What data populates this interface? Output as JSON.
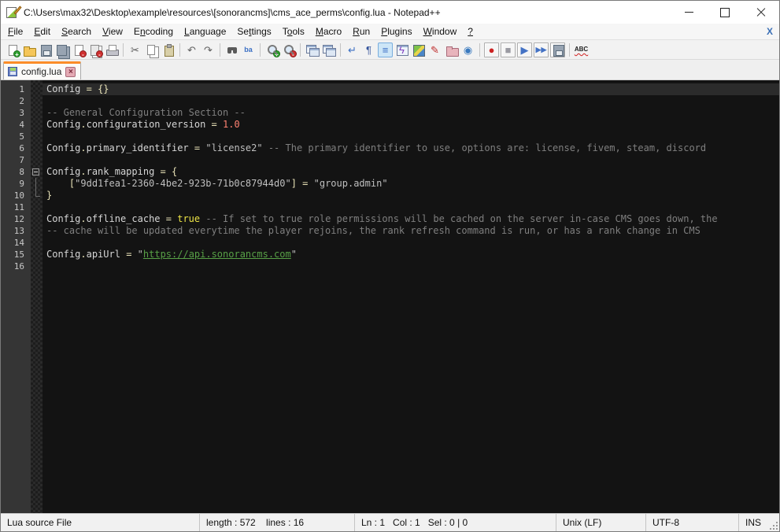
{
  "window": {
    "title": "C:\\Users\\max32\\Desktop\\example\\resources\\[sonorancms]\\cms_ace_perms\\config.lua - Notepad++"
  },
  "menu": {
    "items": [
      {
        "id": "file",
        "pre": "",
        "mn": "F",
        "post": "ile"
      },
      {
        "id": "edit",
        "pre": "",
        "mn": "E",
        "post": "dit"
      },
      {
        "id": "search",
        "pre": "",
        "mn": "S",
        "post": "earch"
      },
      {
        "id": "view",
        "pre": "",
        "mn": "V",
        "post": "iew"
      },
      {
        "id": "encoding",
        "pre": "E",
        "mn": "n",
        "post": "coding"
      },
      {
        "id": "language",
        "pre": "",
        "mn": "L",
        "post": "anguage"
      },
      {
        "id": "settings",
        "pre": "Se",
        "mn": "t",
        "post": "tings"
      },
      {
        "id": "tools",
        "pre": "T",
        "mn": "o",
        "post": "ols"
      },
      {
        "id": "macro",
        "pre": "",
        "mn": "M",
        "post": "acro"
      },
      {
        "id": "run",
        "pre": "",
        "mn": "R",
        "post": "un"
      },
      {
        "id": "plugins",
        "pre": "",
        "mn": "P",
        "post": "lugins"
      },
      {
        "id": "window",
        "pre": "",
        "mn": "W",
        "post": "indow"
      },
      {
        "id": "help",
        "pre": "",
        "mn": "?",
        "post": ""
      }
    ],
    "close_label": "X"
  },
  "toolbar": {
    "items": [
      {
        "name": "new-file-icon",
        "shape": "page",
        "badge": "+",
        "badgeStyle": "plus"
      },
      {
        "name": "open-file-icon",
        "shape": "folder"
      },
      {
        "name": "save-icon",
        "shape": "floppy"
      },
      {
        "name": "save-all-icon",
        "shape": "floppy2"
      },
      {
        "name": "close-icon",
        "shape": "page",
        "badge": "-",
        "badgeStyle": "minus"
      },
      {
        "name": "close-all-icon",
        "shape": "pages",
        "badge": "-",
        "badgeStyle": "minus"
      },
      {
        "name": "print-icon",
        "shape": "printer"
      },
      {
        "sep": true
      },
      {
        "name": "cut-icon",
        "glyph": "✂",
        "color": "#5a5a5a"
      },
      {
        "name": "copy-icon",
        "shape": "copy"
      },
      {
        "name": "paste-icon",
        "shape": "clipboard"
      },
      {
        "sep": true
      },
      {
        "name": "undo-icon",
        "glyph": "↶",
        "color": "#606060"
      },
      {
        "name": "redo-icon",
        "glyph": "↷",
        "color": "#606060"
      },
      {
        "sep": true
      },
      {
        "name": "find-icon",
        "shape": "binoculars"
      },
      {
        "name": "replace-icon",
        "glyph": "ba",
        "color": "#3a6fc4",
        "small": true
      },
      {
        "sep": true
      },
      {
        "name": "zoom-in-icon",
        "shape": "magnifier",
        "badge": "+",
        "badgeStyle": "plus"
      },
      {
        "name": "zoom-out-icon",
        "shape": "magnifier",
        "badge": "-",
        "badgeStyle": "minus"
      },
      {
        "sep": true
      },
      {
        "name": "sync-vertical-scroll-icon",
        "shape": "windows",
        "badge": "",
        "badgeStyle": "lock"
      },
      {
        "name": "sync-horizontal-scroll-icon",
        "shape": "windows",
        "badge": "",
        "badgeStyle": "lock"
      },
      {
        "sep": true
      },
      {
        "name": "word-wrap-icon",
        "glyph": "↵",
        "color": "#3a6fc4"
      },
      {
        "name": "show-all-characters-icon",
        "glyph": "¶",
        "color": "#34549c"
      },
      {
        "name": "indent-guide-icon",
        "glyph": "≡",
        "color": "#3a6fc4",
        "active": true
      },
      {
        "name": "doc-switcher-icon",
        "glyph": "ϟ",
        "color": "#8040c0",
        "shape": "window"
      },
      {
        "name": "document-map-icon",
        "shape": "map"
      },
      {
        "name": "function-list-icon",
        "glyph": "✎",
        "color": "#c03030"
      },
      {
        "name": "folder-as-workspace-icon",
        "shape": "folderpink"
      },
      {
        "name": "monitoring-icon",
        "glyph": "◉",
        "color": "#3a7abf"
      },
      {
        "sep": true
      },
      {
        "name": "macro-record-icon",
        "glyph": "●",
        "color": "#cc2222",
        "shape": "box"
      },
      {
        "name": "macro-stop-icon",
        "glyph": "■",
        "color": "#9a9aa2",
        "shape": "box"
      },
      {
        "name": "macro-play-icon",
        "glyph": "▶",
        "color": "#4472c4",
        "shape": "box"
      },
      {
        "name": "macro-run-multiple-icon",
        "glyph": "▶▶",
        "color": "#4472c4",
        "shape": "box",
        "small": true
      },
      {
        "name": "macro-save-icon",
        "shape": "floppy box"
      },
      {
        "sep": true
      },
      {
        "name": "spell-check-icon",
        "glyph": "ABC",
        "color": "#222222",
        "abc": true
      }
    ]
  },
  "tab": {
    "label": "config.lua",
    "close_label": "×",
    "accent_color": "#fb8c28"
  },
  "editor": {
    "colors": {
      "background": "#131313",
      "current_line": "#2b2b2b",
      "default_text": "#d6d6d6",
      "operator": "#e8e2b7",
      "comment": "#7f7f7f",
      "string": "#bfbfbf",
      "number": "#ff8272",
      "keyword": "#ece345",
      "url": "#57a046"
    },
    "lines": [
      {
        "n": 1,
        "current": true,
        "tokens": [
          [
            "Config",
            "d"
          ],
          [
            " ",
            "d"
          ],
          [
            "=",
            "o"
          ],
          [
            " ",
            "d"
          ],
          [
            "{}",
            "o"
          ]
        ]
      },
      {
        "n": 2,
        "tokens": []
      },
      {
        "n": 3,
        "tokens": [
          [
            "-- General Configuration Section --",
            "c"
          ]
        ]
      },
      {
        "n": 4,
        "tokens": [
          [
            "Config",
            "d"
          ],
          [
            ".",
            "o"
          ],
          [
            "configuration_version",
            "d"
          ],
          [
            " ",
            "d"
          ],
          [
            "=",
            "o"
          ],
          [
            " ",
            "d"
          ],
          [
            "1.0",
            "n"
          ]
        ]
      },
      {
        "n": 5,
        "tokens": []
      },
      {
        "n": 6,
        "tokens": [
          [
            "Config",
            "d"
          ],
          [
            ".",
            "o"
          ],
          [
            "primary_identifier",
            "d"
          ],
          [
            " ",
            "d"
          ],
          [
            "=",
            "o"
          ],
          [
            " ",
            "d"
          ],
          [
            "\"license2\"",
            "s"
          ],
          [
            " ",
            "d"
          ],
          [
            "-- The primary identifier to use, options are: license, fivem, steam, discord",
            "c"
          ]
        ]
      },
      {
        "n": 7,
        "tokens": []
      },
      {
        "n": 8,
        "fold": "open",
        "tokens": [
          [
            "Config",
            "d"
          ],
          [
            ".",
            "o"
          ],
          [
            "rank_mapping",
            "d"
          ],
          [
            " ",
            "d"
          ],
          [
            "=",
            "o"
          ],
          [
            " ",
            "d"
          ],
          [
            "{",
            "o"
          ]
        ]
      },
      {
        "n": 9,
        "fold": "guide",
        "tokens": [
          [
            "    ",
            "d"
          ],
          [
            "[",
            "o"
          ],
          [
            "\"9dd1fea1-2360-4be2-923b-71b0c87944d0\"",
            "s"
          ],
          [
            "]",
            "o"
          ],
          [
            " ",
            "d"
          ],
          [
            "=",
            "o"
          ],
          [
            " ",
            "d"
          ],
          [
            "\"group.admin\"",
            "s"
          ]
        ]
      },
      {
        "n": 10,
        "fold": "end",
        "tokens": [
          [
            "}",
            "o"
          ]
        ]
      },
      {
        "n": 11,
        "tokens": []
      },
      {
        "n": 12,
        "tokens": [
          [
            "Config",
            "d"
          ],
          [
            ".",
            "o"
          ],
          [
            "offline_cache",
            "d"
          ],
          [
            " ",
            "d"
          ],
          [
            "=",
            "o"
          ],
          [
            " ",
            "d"
          ],
          [
            "true",
            "k"
          ],
          [
            " ",
            "d"
          ],
          [
            "-- If set to true role permissions will be cached on the server in-case CMS goes down, the",
            "c"
          ]
        ]
      },
      {
        "n": 13,
        "tokens": [
          [
            "-- cache will be updated everytime the player rejoins, the rank refresh command is run, or has a rank change in CMS",
            "c"
          ]
        ]
      },
      {
        "n": 14,
        "tokens": []
      },
      {
        "n": 15,
        "tokens": [
          [
            "Config",
            "d"
          ],
          [
            ".",
            "o"
          ],
          [
            "apiUrl",
            "d"
          ],
          [
            " ",
            "d"
          ],
          [
            "=",
            "o"
          ],
          [
            " ",
            "d"
          ],
          [
            "\"",
            "s"
          ],
          [
            "https://api.sonorancms.com",
            "u"
          ],
          [
            "\"",
            "s"
          ]
        ]
      },
      {
        "n": 16,
        "tokens": []
      }
    ]
  },
  "status_bar": {
    "doc_type": "Lua source File",
    "length_lines": "length : 572    lines : 16",
    "position": "Ln : 1   Col : 1   Sel : 0 | 0",
    "eol": "Unix (LF)",
    "encoding": "UTF-8",
    "insert_mode": "INS"
  }
}
